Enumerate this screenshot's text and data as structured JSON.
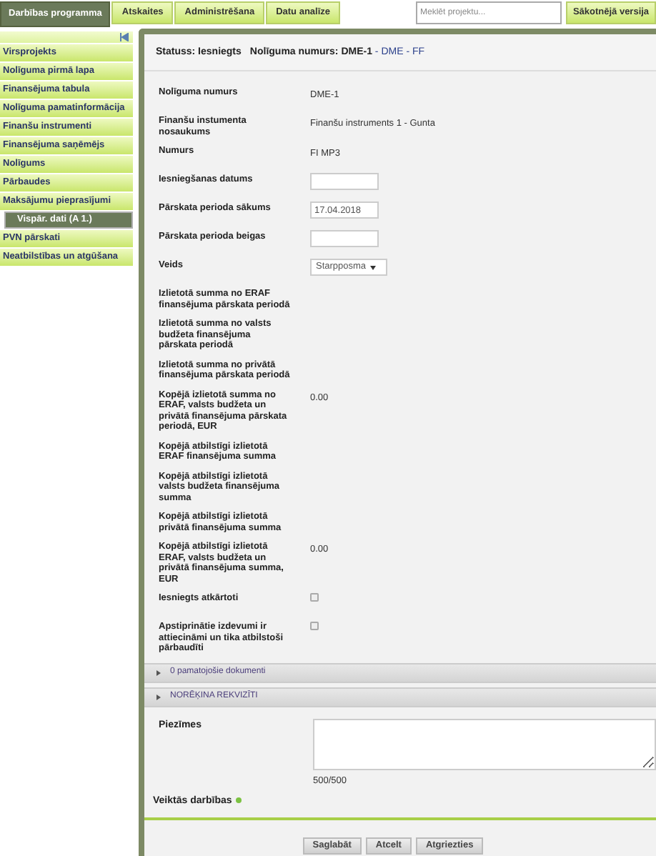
{
  "top_tabs": [
    {
      "label": "Darbības programma",
      "selected": true
    },
    {
      "label": "Atskaites",
      "selected": false
    },
    {
      "label": "Administrēšana",
      "selected": false
    },
    {
      "label": "Datu analīze",
      "selected": false
    }
  ],
  "search": {
    "placeholder": "Meklēt projektu..."
  },
  "version_button": "Sākotnējā versija",
  "sidebar": {
    "items": [
      {
        "label": "Virsprojekts",
        "selected": false
      },
      {
        "label": "Nolīguma pirmā lapa",
        "selected": false
      },
      {
        "label": "Finansējuma tabula",
        "selected": false
      },
      {
        "label": "Nolīguma pamatinformācija",
        "selected": false
      },
      {
        "label": "Finanšu instrumenti",
        "selected": false
      },
      {
        "label": "Finansējuma saņēmējs",
        "selected": false
      },
      {
        "label": "Nolīgums",
        "selected": false
      },
      {
        "label": "Pārbaudes",
        "selected": false
      },
      {
        "label": "Maksājumu pieprasījumi",
        "selected": false,
        "children": [
          {
            "label": "Vispār. dati (A 1.)",
            "selected": true
          }
        ]
      },
      {
        "label": "PVN pārskati",
        "selected": false
      },
      {
        "label": "Neatbilstības un atgūšana",
        "selected": false
      }
    ]
  },
  "header": {
    "status": "Statuss: Iesniegts",
    "contract_label": "Nolīguma numurs: DME-1",
    "contract_suffix": " - DME - FF"
  },
  "fields": [
    {
      "kind": "text",
      "label": "Nolīguma numurs",
      "value": "DME-1"
    },
    {
      "kind": "text",
      "label": "Finanšu instumenta nosaukums",
      "value": "Finanšu instruments 1 - Gunta"
    },
    {
      "kind": "text",
      "label": "Numurs",
      "value": "FI MP3"
    },
    {
      "kind": "input",
      "label": "Iesniegšanas datums"
    },
    {
      "kind": "input",
      "label": "Pārskata perioda sākums",
      "value": "17.04.2018"
    },
    {
      "kind": "input",
      "label": "Pārskata perioda beigas"
    },
    {
      "kind": "select",
      "label": "Veids",
      "value": "Starpposma"
    },
    {
      "kind": "text",
      "label": "Izlietotā summa no ERAF finansējuma pārskata periodā"
    },
    {
      "kind": "text",
      "label": "Izlietotā summa no valsts budžeta finansējuma pārskata periodā"
    },
    {
      "kind": "text",
      "label": "Izlietotā summa no privātā finansējuma pārskata periodā"
    },
    {
      "kind": "text",
      "label": "Kopējā izlietotā summa no ERAF, valsts budžeta un privātā finansējuma pārskata periodā, EUR",
      "value": "0.00"
    },
    {
      "kind": "text",
      "label": "Kopējā atbilstīgi izlietotā ERAF finansējuma summa"
    },
    {
      "kind": "text",
      "label": "Kopējā atbilstīgi izlietotā valsts budžeta finansējuma summa"
    },
    {
      "kind": "text",
      "label": "Kopējā atbilstīgi izlietotā privātā finansējuma summa"
    },
    {
      "kind": "text",
      "label": "Kopējā atbilstīgi izlietotā ERAF, valsts budžeta un privātā finansējuma summa, EUR",
      "value": "0.00"
    },
    {
      "kind": "checkbox",
      "label": "Iesniegts atkārtoti",
      "checked": false
    },
    {
      "kind": "checkbox",
      "label": "Apstiprinātie izdevumi ir attiecināmi un tika atbilstoši pārbaudīti",
      "checked": false
    }
  ],
  "sections": [
    {
      "label": "0 pamatojošie dokumenti",
      "expanded": false
    },
    {
      "label": "NORĒĶINA REKVIZĪTI",
      "expanded": false
    }
  ],
  "notes": {
    "label": "Piezīmes",
    "counter": "500/500"
  },
  "actions_label": "Veiktās darbības",
  "buttons": [
    "Saglabāt",
    "Atcelt",
    "Atgriezties"
  ]
}
